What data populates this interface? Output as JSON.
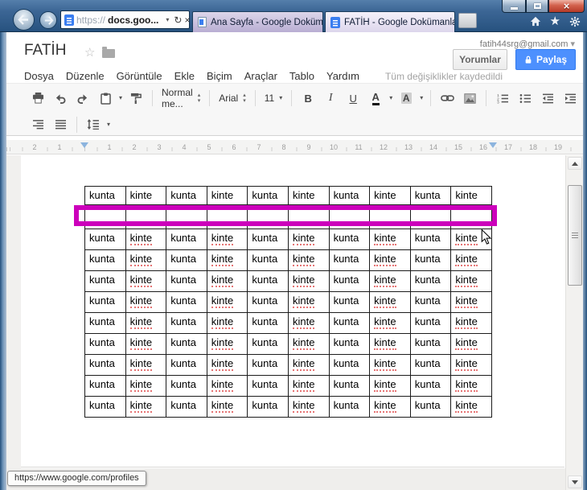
{
  "window_controls": {
    "minimize": "minimize",
    "maximize": "maximize",
    "close": "close"
  },
  "browser": {
    "address": {
      "scheme": "https://",
      "host": "docs.goo..."
    },
    "tabs": [
      {
        "title": "Ana Sayfa - Google Dokümanlar",
        "active": false
      },
      {
        "title": "FATİH - Google Dokümanlar",
        "active": true
      }
    ],
    "status_tooltip": "https://www.google.com/profiles"
  },
  "docs": {
    "title": "FATİH",
    "account_email": "fatih44srg@gmail.com",
    "account_caret": "▾",
    "comments_button": "Yorumlar",
    "share_button": "Paylaş",
    "menu_items": [
      "Dosya",
      "Düzenle",
      "Görüntüle",
      "Ekle",
      "Biçim",
      "Araçlar",
      "Tablo",
      "Yardım"
    ],
    "save_status": "Tüm değişiklikler kaydedildi",
    "toolbar": {
      "style_value": "Normal me...",
      "font_value": "Arial",
      "size_value": "11",
      "bold": "B",
      "italic": "I",
      "underline": "U",
      "text_color_letter": "A",
      "highlight_letter": "A"
    },
    "ruler": {
      "left_numbers": [
        "2",
        "1"
      ],
      "right_numbers": [
        "1",
        "2",
        "3",
        "4",
        "5",
        "6",
        "7",
        "8",
        "9",
        "10",
        "11",
        "12",
        "13",
        "14",
        "15",
        "16",
        "17",
        "18",
        "19"
      ]
    },
    "table": {
      "rows": [
        {
          "empty": false,
          "spellcheck": false,
          "cells": [
            "kunta",
            "kinte",
            "kunta",
            "kinte",
            "kunta",
            "kinte",
            "kunta",
            "kinte",
            "kunta",
            "kinte"
          ]
        },
        {
          "empty": true,
          "spellcheck": false,
          "cells": [
            "",
            "",
            "",
            "",
            "",
            "",
            "",
            "",
            "",
            ""
          ]
        },
        {
          "empty": false,
          "spellcheck": true,
          "cells": [
            "kunta",
            "kinte",
            "kunta",
            "kinte",
            "kunta",
            "kinte",
            "kunta",
            "kinte",
            "kunta",
            "kinte"
          ]
        },
        {
          "empty": false,
          "spellcheck": true,
          "cells": [
            "kunta",
            "kinte",
            "kunta",
            "kinte",
            "kunta",
            "kinte",
            "kunta",
            "kinte",
            "kunta",
            "kinte"
          ]
        },
        {
          "empty": false,
          "spellcheck": true,
          "cells": [
            "kunta",
            "kinte",
            "kunta",
            "kinte",
            "kunta",
            "kinte",
            "kunta",
            "kinte",
            "kunta",
            "kinte"
          ]
        },
        {
          "empty": false,
          "spellcheck": true,
          "cells": [
            "kunta",
            "kinte",
            "kunta",
            "kinte",
            "kunta",
            "kinte",
            "kunta",
            "kinte",
            "kunta",
            "kinte"
          ]
        },
        {
          "empty": false,
          "spellcheck": true,
          "cells": [
            "kunta",
            "kinte",
            "kunta",
            "kinte",
            "kunta",
            "kinte",
            "kunta",
            "kinte",
            "kunta",
            "kinte"
          ]
        },
        {
          "empty": false,
          "spellcheck": true,
          "cells": [
            "kunta",
            "kinte",
            "kunta",
            "kinte",
            "kunta",
            "kinte",
            "kunta",
            "kinte",
            "kunta",
            "kinte"
          ]
        },
        {
          "empty": false,
          "spellcheck": true,
          "cells": [
            "kunta",
            "kinte",
            "kunta",
            "kinte",
            "kunta",
            "kinte",
            "kunta",
            "kinte",
            "kunta",
            "kinte"
          ]
        },
        {
          "empty": false,
          "spellcheck": true,
          "cells": [
            "kunta",
            "kinte",
            "kunta",
            "kinte",
            "kunta",
            "kinte",
            "kunta",
            "kinte",
            "kunta",
            "kinte"
          ]
        },
        {
          "empty": false,
          "spellcheck": true,
          "cells": [
            "kunta",
            "kinte",
            "kunta",
            "kinte",
            "kunta",
            "kinte",
            "kunta",
            "kinte",
            "kunta",
            "kinte"
          ]
        }
      ]
    },
    "annotation_color": "#cc00bb"
  }
}
